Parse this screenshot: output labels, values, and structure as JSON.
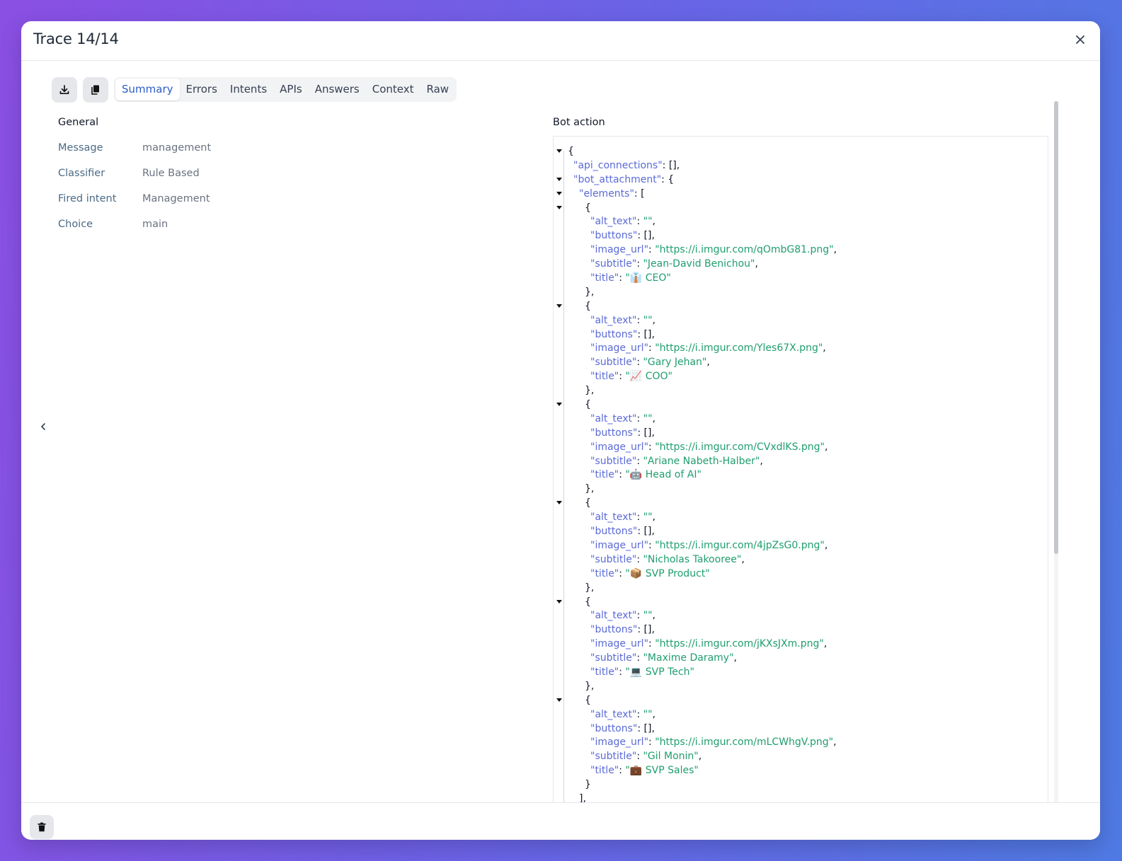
{
  "header": {
    "title": "Trace 14/14"
  },
  "toolbar": {
    "tabs": [
      {
        "label": "Summary",
        "active": true
      },
      {
        "label": "Errors"
      },
      {
        "label": "Intents"
      },
      {
        "label": "APIs"
      },
      {
        "label": "Answers"
      },
      {
        "label": "Context"
      },
      {
        "label": "Raw"
      }
    ]
  },
  "general": {
    "title": "General",
    "rows": [
      {
        "key": "Message",
        "value": "management"
      },
      {
        "key": "Classifier",
        "value": "Rule Based"
      },
      {
        "key": "Fired intent",
        "value": "Management"
      },
      {
        "key": "Choice",
        "value": "main"
      }
    ]
  },
  "bot_action": {
    "title": "Bot action",
    "api_connections": "[]",
    "elements": [
      {
        "alt_text": "",
        "buttons": "[]",
        "image_url": "https://i.imgur.com/qOmbG81.png",
        "subtitle": "Jean-David Benichou",
        "title": "👔 CEO"
      },
      {
        "alt_text": "",
        "buttons": "[]",
        "image_url": "https://i.imgur.com/Yles67X.png",
        "subtitle": "Gary Jehan",
        "title": "📈 COO"
      },
      {
        "alt_text": "",
        "buttons": "[]",
        "image_url": "https://i.imgur.com/CVxdlKS.png",
        "subtitle": "Ariane Nabeth-Halber",
        "title": "🤖 Head of AI"
      },
      {
        "alt_text": "",
        "buttons": "[]",
        "image_url": "https://i.imgur.com/4jpZsG0.png",
        "subtitle": "Nicholas Takooree",
        "title": "📦 SVP Product"
      },
      {
        "alt_text": "",
        "buttons": "[]",
        "image_url": "https://i.imgur.com/jKXsJXm.png",
        "subtitle": "Maxime Daramy",
        "title": "💻 SVP Tech"
      },
      {
        "alt_text": "",
        "buttons": "[]",
        "image_url": "https://i.imgur.com/mLCWhgV.png",
        "subtitle": "Gil Monin",
        "title": "💼 SVP Sales"
      }
    ]
  },
  "colors": {
    "json_key": "#5a6ad6",
    "json_string": "#1f9e6e",
    "active_tab": "#2b5cc8"
  },
  "icons": {
    "download": "download-icon",
    "copy": "copy-icon",
    "close": "close-icon",
    "collapse": "chevron-left-icon",
    "delete": "trash-icon"
  }
}
